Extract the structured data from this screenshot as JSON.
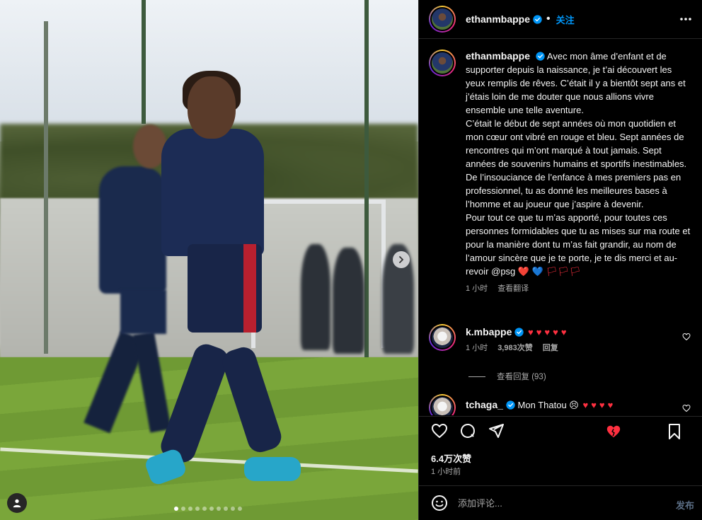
{
  "header": {
    "username": "ethanmbappe",
    "follow_label": "关注"
  },
  "caption": {
    "username": "ethanmbappe",
    "text": "Avec mon âme d’enfant et de supporter depuis la naissance, je t’ai découvert les yeux remplis de rêves. C’était il y a bientôt sept ans et j’étais loin de me douter que nous allions vivre ensemble une telle aventure.\nC’était le début de sept années où mon quotidien et mon cœur ont vibré en rouge et bleu. Sept années de rencontres qui m’ont marqué à tout jamais. Sept années de souvenirs humains et sportifs inestimables. De l’insouciance de l’enfance à mes premiers pas en professionnel, tu as donné les meilleures bases à l’homme et au joueur que j’aspire à devenir.\nPour tout ce que tu m’as apporté, pour toutes ces personnes formidables que tu as mises sur ma route et pour la manière dont tu m’as fait grandir, au nom de l’amour sincère que je te porte, je te dis merci et au-revoir @psg",
    "emoji_tail": "❤️ 💙 🏳🏳🏳",
    "time": "1 小时",
    "translate_label": "查看翻译"
  },
  "comments": [
    {
      "username": "k.mbappe",
      "text": "",
      "hearts": "♥♥♥♥♥",
      "time": "1 小时",
      "likes": "3,983次赞",
      "reply_label": "回复"
    },
    {
      "username": "tchaga_",
      "text": "Mon Thatou 😣",
      "hearts": "♥♥♥♥"
    }
  ],
  "view_replies_label": "查看回复 (93)",
  "post": {
    "likes": "6.4万次赞",
    "posted": "1 小时前"
  },
  "comment_box": {
    "placeholder": "添加评论...",
    "post_label": "发布"
  },
  "carousel": {
    "total": 10,
    "active": 1
  },
  "colors": {
    "accent": "#0095f6",
    "heart": "#ff3040",
    "background": "#000000",
    "muted": "#a8a8a8"
  }
}
